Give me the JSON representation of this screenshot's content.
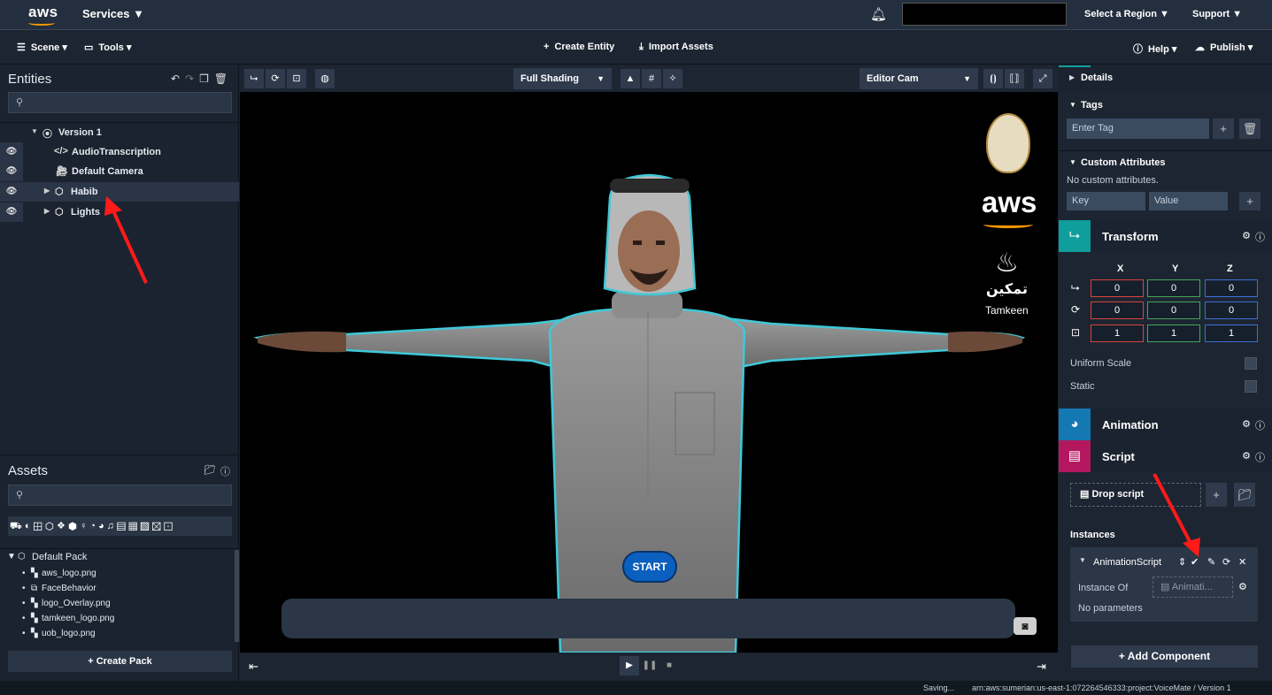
{
  "aws_bar": {
    "logo": "aws",
    "services": "Services ▼",
    "region": "Select a Region",
    "support": "Support"
  },
  "toolbar": {
    "scene": "Scene",
    "tools": "Tools",
    "create_entity": "Create Entity",
    "import_assets": "Import Assets",
    "help": "Help",
    "publish": "Publish"
  },
  "entities": {
    "title": "Entities",
    "items": [
      {
        "label": "Version 1"
      },
      {
        "label": "AudioTranscription"
      },
      {
        "label": "Default Camera"
      },
      {
        "label": "Habib"
      },
      {
        "label": "Lights"
      }
    ]
  },
  "assets": {
    "title": "Assets",
    "pack_name": "Default Pack",
    "files": [
      "aws_logo.png",
      "FaceBehavior",
      "logo_Overlay.png",
      "tamkeen_logo.png",
      "uob_logo.png"
    ],
    "create_pack": "Create Pack"
  },
  "viewport": {
    "shading": "Full Shading",
    "camera": "Editor Cam",
    "start_label": "START",
    "logo_aws": "aws",
    "logo_tamkeen_ar": "تمكين",
    "logo_tamkeen_en": "Tamkeen"
  },
  "details": {
    "title": "Details",
    "tags_title": "Tags",
    "tag_placeholder": "Enter Tag",
    "custom_attr_title": "Custom Attributes",
    "no_custom": "No custom attributes.",
    "key_placeholder": "Key",
    "value_placeholder": "Value"
  },
  "transform": {
    "title": "Transform",
    "headers": [
      "X",
      "Y",
      "Z"
    ],
    "translation": [
      "0",
      "0",
      "0"
    ],
    "rotation": [
      "0",
      "0",
      "0"
    ],
    "scale": [
      "1",
      "1",
      "1"
    ],
    "uniform_scale": "Uniform Scale",
    "static": "Static"
  },
  "animation": {
    "title": "Animation"
  },
  "script": {
    "title": "Script",
    "drop_script": "Drop script",
    "instances_title": "Instances",
    "instance_name": "AnimationScript",
    "instance_of_label": "Instance Of",
    "instance_of_value": "Animati...",
    "no_params": "No parameters"
  },
  "add_component": "Add Component",
  "status": {
    "saving": "Saving...",
    "arn": "arn:aws:sumerian:us-east-1:072264546333:project:VoiceMate / Version 1"
  },
  "colors": {
    "transform_accent": "#0f9e9b",
    "animation_accent": "#1478b3",
    "script_accent": "#b3185f",
    "start_button": "#0a5fbf",
    "outline": "#40c8d8"
  }
}
